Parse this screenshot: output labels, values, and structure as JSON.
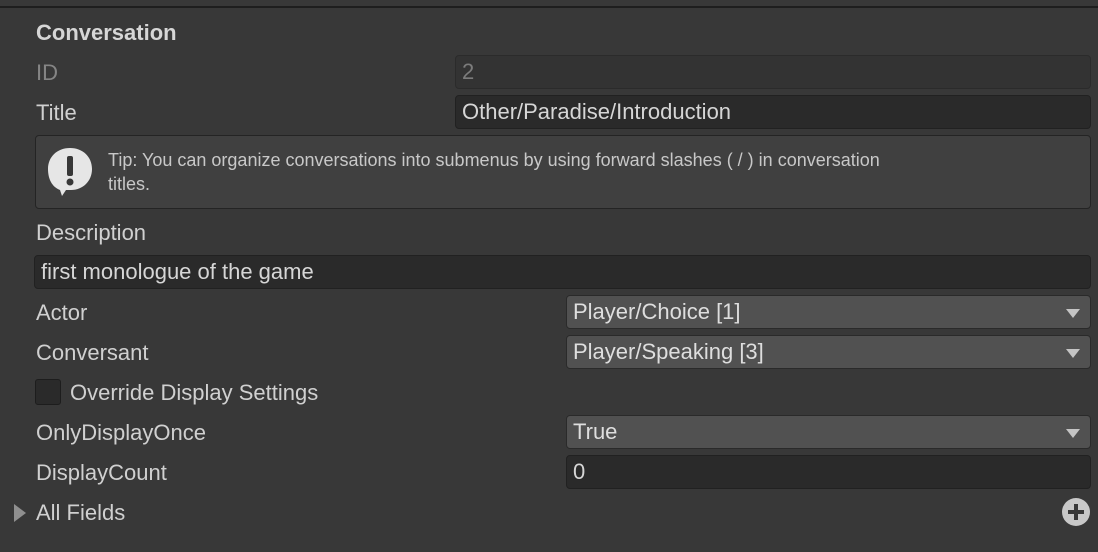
{
  "section": {
    "title": "Conversation"
  },
  "id_field": {
    "label": "ID",
    "value": "2"
  },
  "title_field": {
    "label": "Title",
    "value": "Other/Paradise/Introduction"
  },
  "tip": {
    "icon": "exclamation-icon",
    "line1": "Tip: You can organize conversations into submenus by using forward slashes ( / ) in conversation",
    "line2": "titles."
  },
  "description": {
    "label": "Description",
    "value": "first monologue of the game"
  },
  "actor": {
    "label": "Actor",
    "value": "Player/Choice [1]"
  },
  "conversant": {
    "label": "Conversant",
    "value": "Player/Speaking [3]"
  },
  "override": {
    "label": "Override Display Settings",
    "checked": false
  },
  "only_display_once": {
    "label": "OnlyDisplayOnce",
    "value": "True"
  },
  "display_count": {
    "label": "DisplayCount",
    "value": "0"
  },
  "all_fields": {
    "label": "All Fields",
    "expanded": false
  },
  "colors": {
    "background": "#383838",
    "field_bg": "#2a2a2a",
    "dropdown_bg": "#515151",
    "text": "#d0d0d0",
    "disabled_text": "#858585"
  }
}
